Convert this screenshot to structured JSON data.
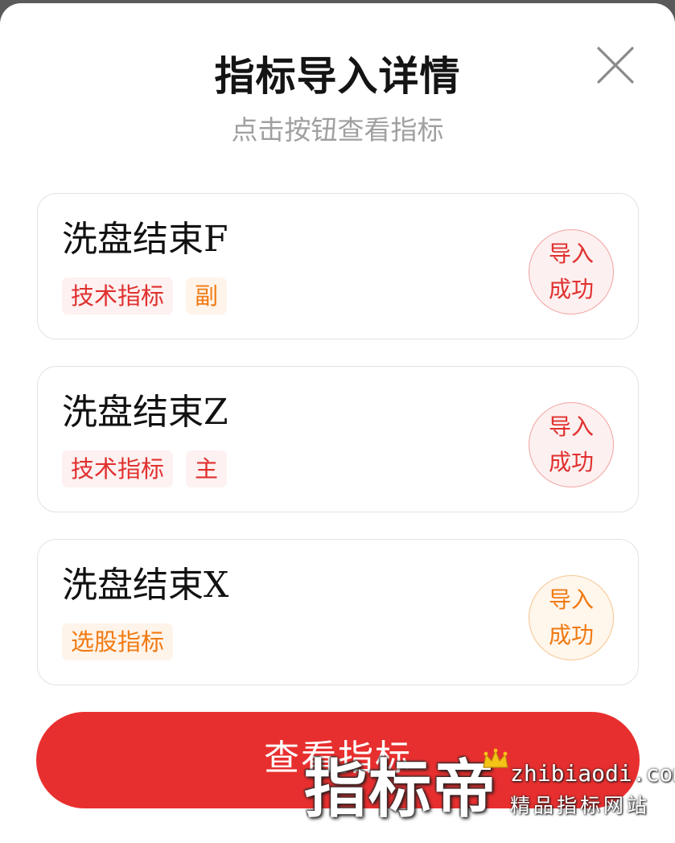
{
  "dialog": {
    "title": "指标导入详情",
    "subtitle": "点击按钮查看指标",
    "close_icon": "close-icon"
  },
  "indicators": [
    {
      "name": "洗盘结束F",
      "tags": [
        {
          "label": "技术指标",
          "color": "#e0312f"
        },
        {
          "label": "副",
          "color": "#f07a12"
        }
      ],
      "status_line1": "导入",
      "status_line2": "成功",
      "status_color": "#e0312f"
    },
    {
      "name": "洗盘结束Z",
      "tags": [
        {
          "label": "技术指标",
          "color": "#e0312f"
        },
        {
          "label": "主",
          "color": "#e0312f"
        }
      ],
      "status_line1": "导入",
      "status_line2": "成功",
      "status_color": "#e0312f"
    },
    {
      "name": "洗盘结束X",
      "tags": [
        {
          "label": "选股指标",
          "color": "#f07a12"
        }
      ],
      "status_line1": "导入",
      "status_line2": "成功",
      "status_color": "#f07a12"
    }
  ],
  "primary_button": {
    "label": "查看指标",
    "color": "#e82f2f"
  },
  "watermark": {
    "brand": "指标帝",
    "domain": "zhibiaodi.com",
    "slogan": "精品指标网站",
    "icon": "crown-icon"
  }
}
